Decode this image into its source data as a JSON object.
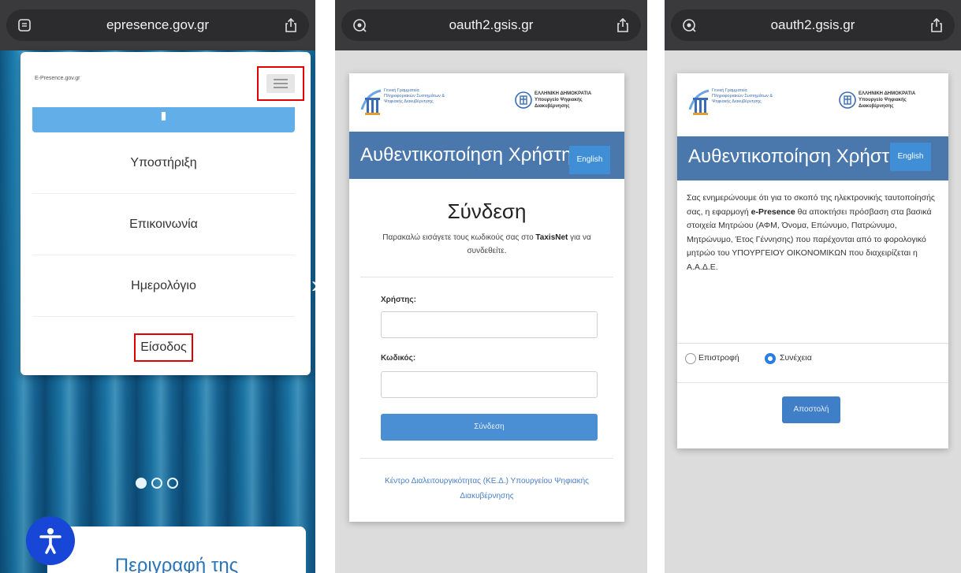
{
  "panel1": {
    "url": "epresence.gov.gr",
    "site_logo_text": "E-Presence.gov.gr",
    "menu_items": [
      "Υποστήριξη",
      "Επικοινωνία",
      "Ημερολόγιο"
    ],
    "login_item": "Είσοδος",
    "carousel": {
      "total": 3,
      "active": 0
    },
    "description_heading": "Περιγραφή της"
  },
  "panel2": {
    "url": "oauth2.gsis.gr",
    "logo_left_text": "Γενική Γραμματεία Πληροφοριακών Συστημάτων & Ψηφιακής Διακυβέρνησης",
    "logo_right_text": "ΕΛΛΗΝΙΚΗ ΔΗΜΟΚΡΑΤΙΑ Υπουργείο Ψηφιακής Διακυβέρνησης",
    "banner_title": "Αυθεντικοποίηση Χρήστη",
    "english_label": "English",
    "login_title": "Σύνδεση",
    "instructions_before": "Παρακαλώ εισάγετε τους κωδικούς σας στο",
    "instructions_bold": "TaxisNet",
    "instructions_after": "για να συνδεθείτε.",
    "username_label": "Χρήστης:",
    "password_label": "Κωδικός:",
    "submit_label": "Σύνδεση",
    "footer_text": "Κέντρο Διαλειτουργικότητας (ΚΕ.Δ.) Υπουργείου Ψηφιακής Διακυβέρνησης"
  },
  "panel3": {
    "url": "oauth2.gsis.gr",
    "logo_left_text": "Γενική Γραμματεία Πληροφοριακών Συστημάτων & Ψηφιακής Διακυβέρνησης",
    "logo_right_text": "ΕΛΛΗΝΙΚΗ ΔΗΜΟΚΡΑΤΙΑ Υπουργείο Ψηφιακής Διακυβέρνησης",
    "banner_title": "Αυθεντικοποίηση Χρήστη",
    "english_label": "English",
    "consent_before": "Σας ενημερώνουμε ότι για το σκοπό της ηλεκτρονικής ταυτοποίησής σας, η εφαρμογή",
    "consent_app": "e-Presence",
    "consent_after": "θα αποκτήσει πρόσβαση στα βασικά στοιχεία Μητρώου (ΑΦΜ, Όνομα, Επώνυμο, Πατρώνυμο, Μητρώνυμο, Έτος Γέννησης) που παρέχονται από το φορολογικό μητρώο του ΥΠΟΥΡΓΕΙΟΥ ΟΙΚΟΝΟΜΙΚΩΝ που διαχειρίζεται η Α.Α.Δ.Ε.",
    "option_return": "Επιστροφή",
    "option_continue": "Συνέχεια",
    "selected_option": "continue",
    "send_label": "Αποστολή"
  },
  "colors": {
    "banner": "#4a78ad",
    "english_button": "#3f8ed6",
    "primary_button": "#4a8fd4",
    "highlight_box": "#e00000",
    "accessibility_button": "#1846d6"
  },
  "icons": {
    "url_left_p1": "reader-mode-icon",
    "url_left_p2": "translate-icon",
    "url_right": "share-icon",
    "accessibility": "accessibility-person-icon"
  }
}
